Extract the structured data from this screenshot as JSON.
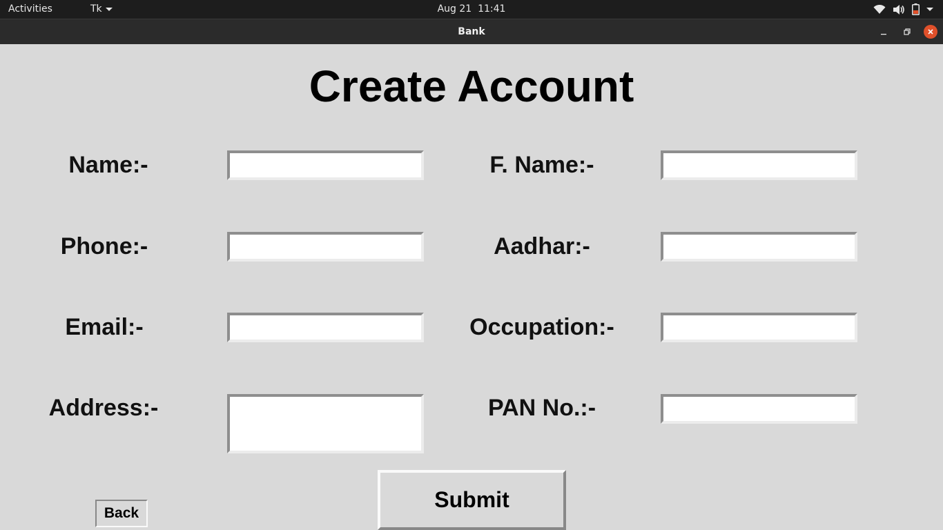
{
  "topbar": {
    "activities": "Activities",
    "app_menu": "Tk",
    "date": "Aug 21",
    "time": "11:41",
    "tray_icons": [
      "wifi-icon",
      "volume-icon",
      "battery-icon",
      "system-menu-icon"
    ]
  },
  "window": {
    "title": "Bank",
    "controls": [
      "minimize-icon",
      "restore-icon",
      "close-icon"
    ]
  },
  "form": {
    "heading": "Create Account",
    "fields": {
      "name": {
        "label": "Name:-",
        "value": ""
      },
      "father_name": {
        "label": "F. Name:-",
        "value": ""
      },
      "phone": {
        "label": "Phone:-",
        "value": ""
      },
      "aadhar": {
        "label": "Aadhar:-",
        "value": ""
      },
      "email": {
        "label": "Email:-",
        "value": ""
      },
      "occupation": {
        "label": "Occupation:-",
        "value": ""
      },
      "address": {
        "label": "Address:-",
        "value": ""
      },
      "pan": {
        "label": "PAN No.:-",
        "value": ""
      }
    },
    "submit_label": "Submit",
    "back_label": "Back"
  },
  "colors": {
    "background": "#d9d9d9",
    "topbar": "#1d1d1d",
    "titlebar": "#2b2b2b",
    "close_button": "#e0502a"
  }
}
